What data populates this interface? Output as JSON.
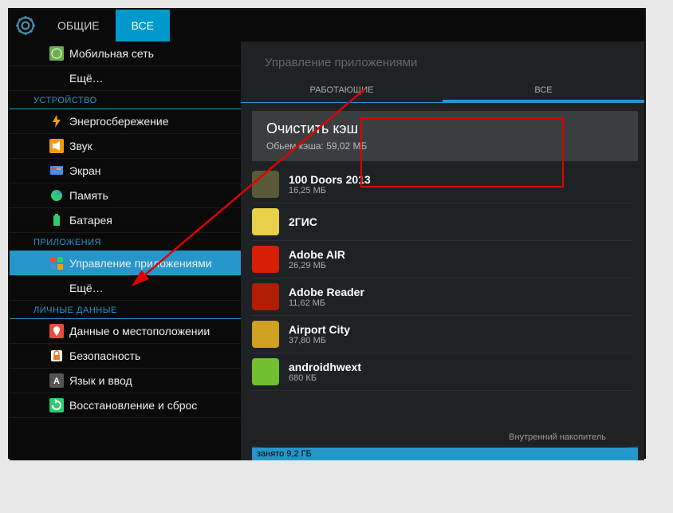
{
  "tabs": {
    "left": "ОБЩИЕ",
    "right": "ВСЕ"
  },
  "sidebar": {
    "s0": [
      {
        "label": "Мобильная сеть",
        "icon": "globe"
      },
      {
        "label": "Ещё…",
        "icon": null
      }
    ],
    "h1": "УСТРОЙСТВО",
    "s1": [
      {
        "label": "Энергосбережение",
        "icon": "bolt"
      },
      {
        "label": "Звук",
        "icon": "speaker"
      },
      {
        "label": "Экран",
        "icon": "display"
      },
      {
        "label": "Память",
        "icon": "pie"
      },
      {
        "label": "Батарея",
        "icon": "battery"
      }
    ],
    "h2": "ПРИЛОЖЕНИЯ",
    "s2": [
      {
        "label": "Управление приложениями",
        "icon": "apps",
        "selected": true
      },
      {
        "label": "Ещё…",
        "icon": null
      }
    ],
    "h3": "ЛИЧНЫЕ ДАННЫЕ",
    "s3": [
      {
        "label": "Данные о местоположении",
        "icon": "location"
      },
      {
        "label": "Безопасность",
        "icon": "lock"
      },
      {
        "label": "Язык и ввод",
        "icon": "lang"
      },
      {
        "label": "Восстановление и сброс",
        "icon": "reset"
      }
    ]
  },
  "main": {
    "title": "Управление приложениями",
    "subtabs": {
      "left": "РАБОТАЮЩИЕ",
      "right": "ВСЕ"
    },
    "clear_cache": {
      "title": "Очистить кэш",
      "sub": "Обьем кэша: 59,02 МБ"
    },
    "apps": [
      {
        "name": "100 Doors 2013",
        "size": "16,25 МБ",
        "color": "#5a5a3a"
      },
      {
        "name": "2ГИС",
        "size": "",
        "color": "#e8d048"
      },
      {
        "name": "Adobe AIR",
        "size": "26,29 МБ",
        "color": "#d81e05"
      },
      {
        "name": "Adobe Reader",
        "size": "11,62 МБ",
        "color": "#b01e05"
      },
      {
        "name": "Airport City",
        "size": "37,80 МБ",
        "color": "#d0a020"
      },
      {
        "name": "androidhwext",
        "size": "680 КБ",
        "color": "#70c030"
      }
    ],
    "storage": {
      "label": "Внутренний накопитель",
      "used": "занято 9,2 ГБ"
    }
  }
}
